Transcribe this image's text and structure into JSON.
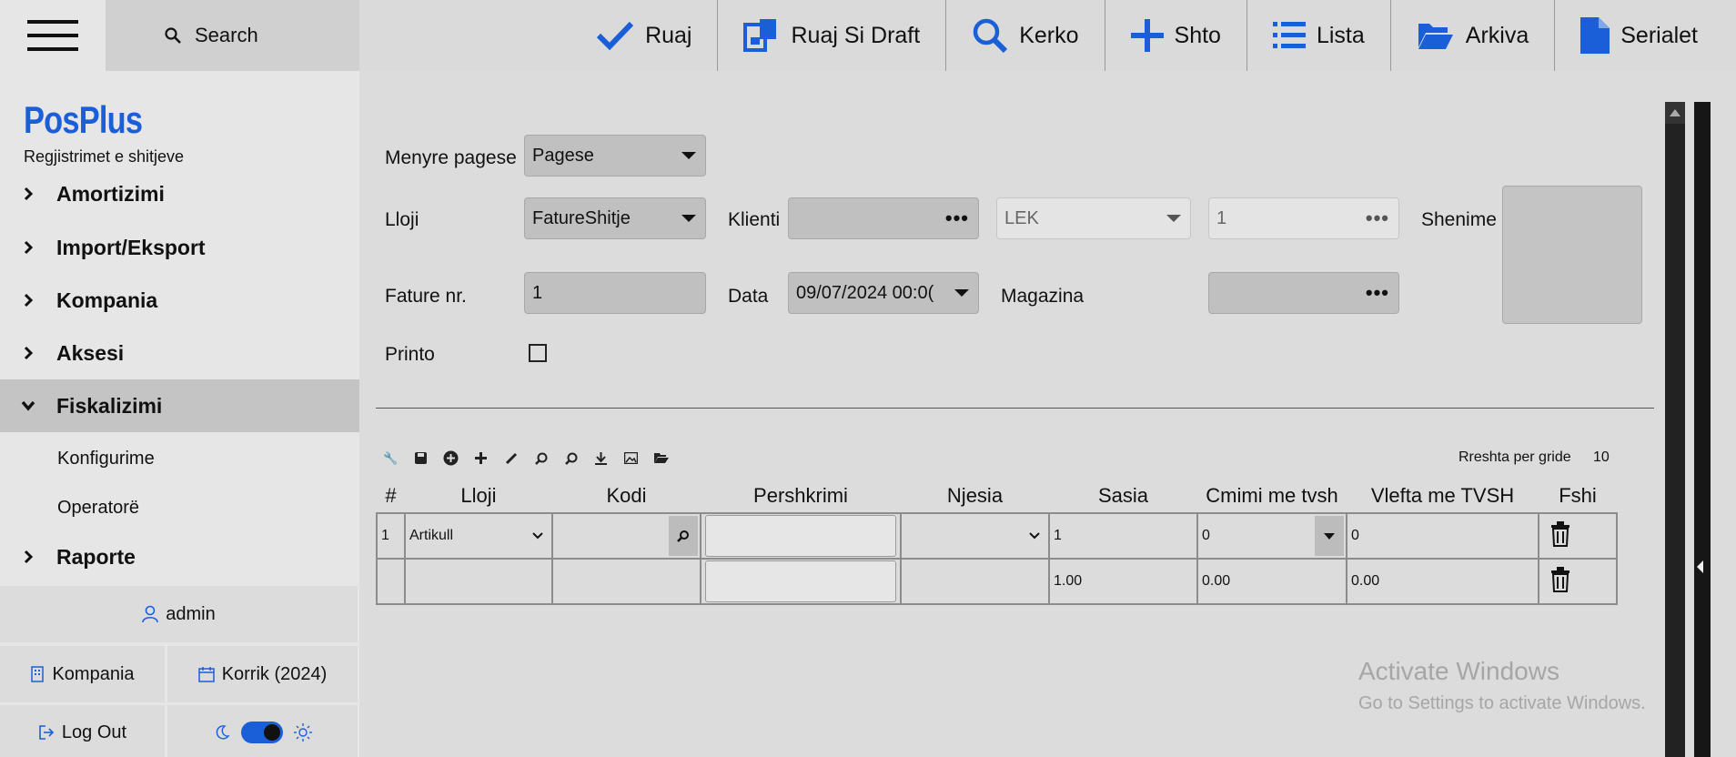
{
  "topbar": {
    "search_label": "Search",
    "buttons": [
      {
        "label": "Ruaj",
        "icon": "check-icon"
      },
      {
        "label": "Ruaj Si Draft",
        "icon": "draft-save-icon"
      },
      {
        "label": "Kerko",
        "icon": "search-icon"
      },
      {
        "label": "Shto",
        "icon": "plus-icon"
      },
      {
        "label": "Lista",
        "icon": "list-icon"
      },
      {
        "label": "Arkiva",
        "icon": "folder-open-icon"
      },
      {
        "label": "Serialet",
        "icon": "document-icon"
      }
    ],
    "accent": "#1a5fd8"
  },
  "sidebar": {
    "brand": "PosPlus",
    "subtitle": "Regjistrimet e shitjeve",
    "items": [
      {
        "label": "Amortizimi"
      },
      {
        "label": "Import/Eksport"
      },
      {
        "label": "Kompania"
      },
      {
        "label": "Aksesi"
      },
      {
        "label": "Fiskalizimi",
        "expanded": true
      },
      {
        "label": "Raporte"
      }
    ],
    "subitems": [
      "Konfigurime",
      "Operatorë"
    ],
    "user": "admin",
    "company": "Kompania",
    "period": "Korrik (2024)",
    "logout": "Log Out"
  },
  "form": {
    "menyre_pagese_label": "Menyre pagese",
    "menyre_pagese_value": "Pagese",
    "lloji_label": "Lloji",
    "lloji_value": "FatureShitje",
    "klienti_label": "Klienti",
    "klienti_value": "",
    "currency_value": "LEK",
    "rate_value": "1",
    "shenime_label": "Shenime",
    "fature_label": "Fature nr.",
    "fature_value": "1",
    "data_label": "Data",
    "data_value": "09/07/2024 00:0(",
    "magazina_label": "Magazina",
    "magazina_value": "",
    "printo_label": "Printo",
    "printo_checked": false
  },
  "grid": {
    "rows_per_page_label": "Rreshta per gride",
    "rows_per_page": "10",
    "headers": [
      "#",
      "Lloji",
      "Kodi",
      "Pershkrimi",
      "Njesia",
      "Sasia",
      "Cmimi me tvsh",
      "Vlefta me TVSH",
      "Fshi"
    ],
    "rows": [
      {
        "idx": "1",
        "lloji": "Artikull",
        "kodi": "",
        "pershkrimi": "",
        "njesia": "",
        "sasia": "1",
        "cmimi": "0",
        "vlefta": "0"
      }
    ],
    "totals": {
      "sasia": "1.00",
      "cmimi": "0.00",
      "vlefta": "0.00"
    }
  },
  "watermark": {
    "title": "Activate Windows",
    "subtitle": "Go to Settings to activate Windows."
  }
}
